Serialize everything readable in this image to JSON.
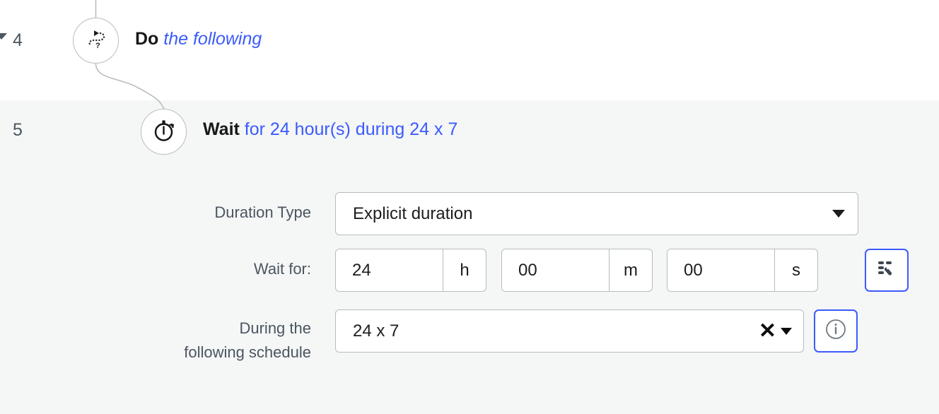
{
  "steps": [
    {
      "number": "4",
      "keyword": "Do",
      "detail": "the following",
      "icon": "dotted-path-question-icon"
    },
    {
      "number": "5",
      "keyword": "Wait",
      "detail": "for 24 hour(s) during 24 x 7",
      "icon": "stopwatch-icon"
    }
  ],
  "form": {
    "duration_type": {
      "label": "Duration Type",
      "value": "Explicit duration"
    },
    "wait_for": {
      "label": "Wait for:",
      "hours": "24",
      "hours_unit": "h",
      "minutes": "00",
      "minutes_unit": "m",
      "seconds": "00",
      "seconds_unit": "s",
      "variable_button_icon": "list-magic-wand-icon"
    },
    "schedule": {
      "label_line1": "During the",
      "label_line2": "following schedule",
      "value": "24 x 7",
      "clear_icon": "close-x-icon",
      "dropdown_icon": "caret-down-icon",
      "info_button_icon": "info-circle-icon"
    }
  },
  "colors": {
    "link_blue": "#3b5bfd",
    "label_slate": "#4a5660",
    "panel_grey": "#f5f6f6",
    "border_grey": "#b6bcc0"
  }
}
